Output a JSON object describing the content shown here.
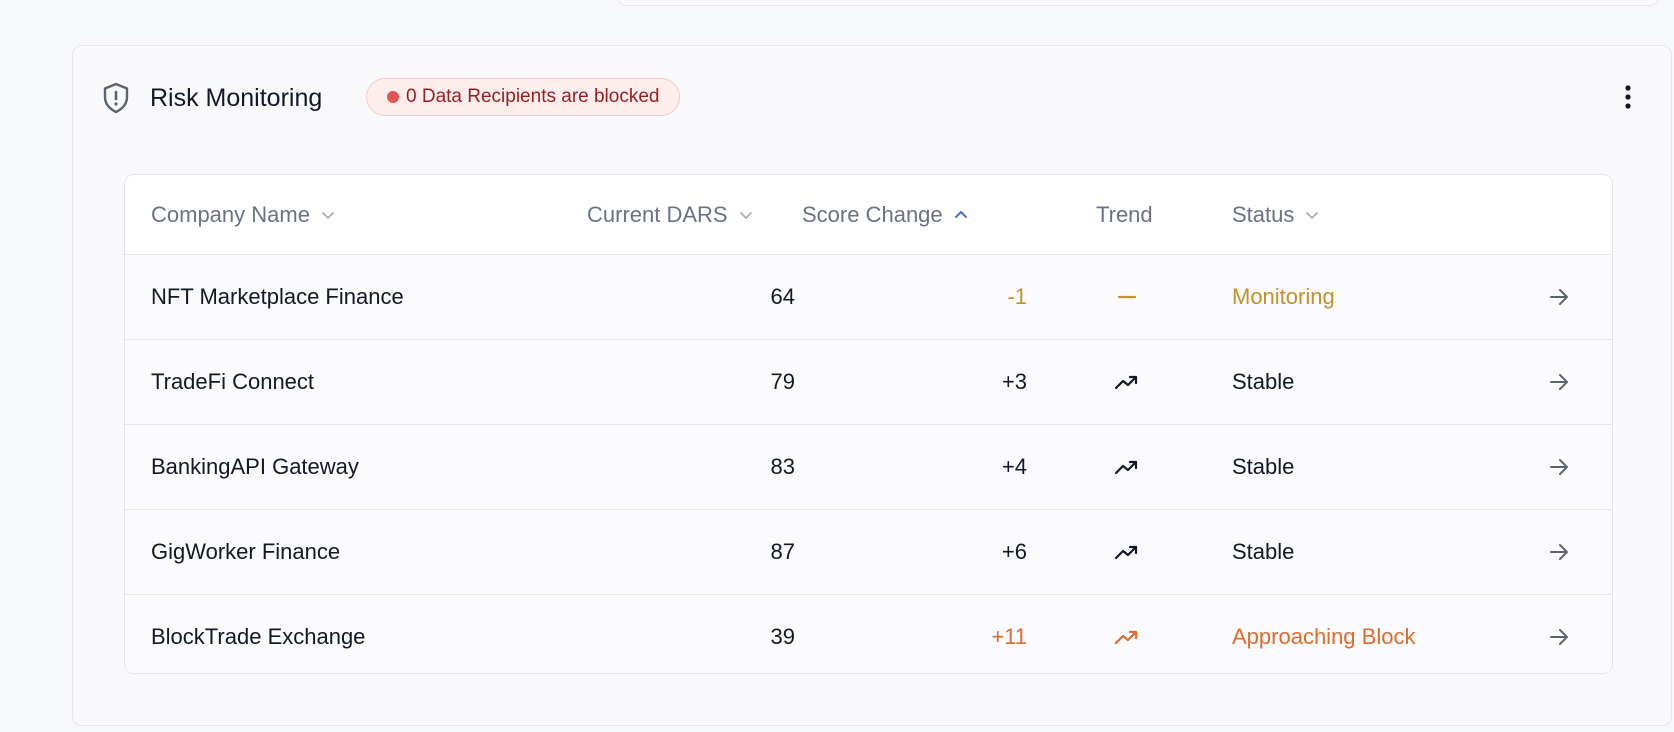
{
  "panel": {
    "title": "Risk Monitoring",
    "icon": "shield-alert-icon",
    "blocked_badge": "0 Data Recipients are blocked",
    "more_icon": "more-vertical-icon"
  },
  "colors": {
    "neutral_text": "#111827",
    "monitoring": "#c1912b",
    "approaching": "#de6a2c",
    "badge_bg": "#fdeeee",
    "badge_dot": "#e25555",
    "badge_text": "#9b1c1c",
    "header_text": "#687385",
    "sort_active": "#4f6bd8"
  },
  "table": {
    "columns": [
      {
        "label": "Company Name",
        "sort_icon": "chevron-down-icon"
      },
      {
        "label": "Current DARS",
        "sort_icon": "chevron-down-icon"
      },
      {
        "label": "Score Change",
        "sort_icon": "chevron-up-icon"
      },
      {
        "label": "Trend"
      },
      {
        "label": "Status",
        "sort_icon": "chevron-down-icon"
      }
    ],
    "rows": [
      {
        "company": "NFT Marketplace Finance",
        "dars": "64",
        "change": "-1",
        "trend": "flat-line-icon",
        "status": "Monitoring",
        "tone": "monitoring"
      },
      {
        "company": "TradeFi Connect",
        "dars": "79",
        "change": "+3",
        "trend": "trending-up-icon",
        "status": "Stable",
        "tone": "neutral"
      },
      {
        "company": "BankingAPI Gateway",
        "dars": "83",
        "change": "+4",
        "trend": "trending-up-icon",
        "status": "Stable",
        "tone": "neutral"
      },
      {
        "company": "GigWorker Finance",
        "dars": "87",
        "change": "+6",
        "trend": "trending-up-icon",
        "status": "Stable",
        "tone": "neutral"
      },
      {
        "company": "BlockTrade Exchange",
        "dars": "39",
        "change": "+11",
        "trend": "trending-up-icon",
        "status": "Approaching Block",
        "tone": "approaching"
      }
    ],
    "row_action_icon": "arrow-right-icon"
  }
}
